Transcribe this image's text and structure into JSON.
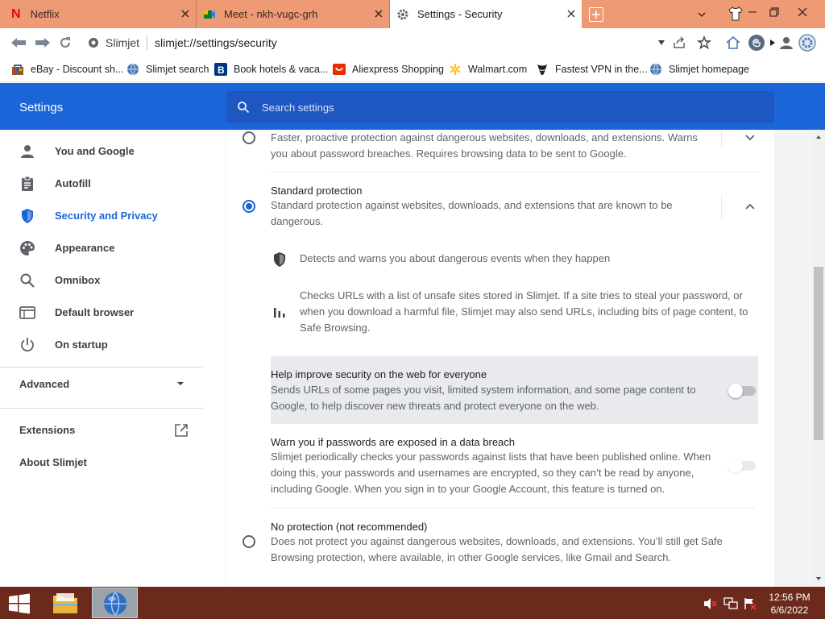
{
  "tabs": [
    {
      "title": "Netflix",
      "active": false
    },
    {
      "title": "Meet - nkh-vugc-grh",
      "active": false
    },
    {
      "title": "Settings - Security",
      "active": true
    }
  ],
  "toolbar": {
    "site_name": "Slimjet",
    "url": "slimjet://settings/security"
  },
  "bookmarks": [
    {
      "label": "eBay - Discount sh...",
      "icon": "ebay-icon"
    },
    {
      "label": "Slimjet search",
      "icon": "globe-icon"
    },
    {
      "label": "Book hotels & vaca...",
      "icon": "booking-icon"
    },
    {
      "label": "Aliexpress Shopping",
      "icon": "aliexpress-icon"
    },
    {
      "label": "Walmart.com",
      "icon": "walmart-icon"
    },
    {
      "label": "Fastest VPN in the...",
      "icon": "vpn-icon"
    },
    {
      "label": "Slimjet homepage",
      "icon": "globe-icon"
    }
  ],
  "settings": {
    "title": "Settings",
    "search_placeholder": "Search settings"
  },
  "sidebar": {
    "items": [
      {
        "label": "You and Google",
        "icon": "person-icon"
      },
      {
        "label": "Autofill",
        "icon": "clipboard-icon"
      },
      {
        "label": "Security and Privacy",
        "icon": "shield-icon",
        "selected": true
      },
      {
        "label": "Appearance",
        "icon": "palette-icon"
      },
      {
        "label": "Omnibox",
        "icon": "search-icon"
      },
      {
        "label": "Default browser",
        "icon": "browser-icon"
      },
      {
        "label": "On startup",
        "icon": "power-icon"
      }
    ],
    "advanced": "Advanced",
    "extensions": "Extensions",
    "about": "About Slimjet"
  },
  "content": {
    "enhanced_desc": "Faster, proactive protection against dangerous websites, downloads, and extensions. Warns you about password breaches. Requires browsing data to be sent to Google.",
    "standard_title": "Standard protection",
    "standard_desc": "Standard protection against websites, downloads, and extensions that are known to be dangerous.",
    "detail1": "Detects and warns you about dangerous events when they happen",
    "detail2": "Checks URLs with a list of unsafe sites stored in Slimjet. If a site tries to steal your password, or when you download a harmful file, Slimjet may also send URLs, including bits of page content, to Safe Browsing.",
    "help_title": "Help improve security on the web for everyone",
    "help_desc": "Sends URLs of some pages you visit, limited system information, and some page content to Google, to help discover new threats and protect everyone on the web.",
    "warn_title": "Warn you if passwords are exposed in a data breach",
    "warn_desc": "Slimjet periodically checks your passwords against lists that have been published online. When doing this, your passwords and usernames are encrypted, so they can’t be read by anyone, including Google. When you sign in to your Google Account, this feature is turned on.",
    "noprot_title": "No protection (not recommended)",
    "noprot_desc": "Does not protect you against dangerous websites, downloads, and extensions. You’ll still get Safe Browsing protection, where available, in other Google services, like Gmail and Search."
  },
  "taskbar": {
    "time": "12:56 PM",
    "date": "6/6/2022"
  },
  "colors": {
    "accent": "#1a66d8",
    "tabstrip": "#ee9a74",
    "taskbar": "#6b2a1b"
  }
}
